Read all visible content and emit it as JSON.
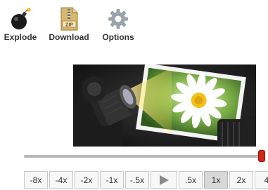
{
  "toolbar": {
    "explode_label": "Explode",
    "download_label": "Download",
    "options_label": "Options",
    "zip_badge": "ZIP"
  },
  "playback": {
    "position": 0.99,
    "speeds_left": [
      "-8x",
      "-4x",
      "-2x",
      "-1x",
      "-.5x"
    ],
    "speeds_right": [
      ".5x",
      "1x",
      "2x",
      "4"
    ],
    "active_speed": "1x"
  },
  "colors": {
    "thumb": "#d62418",
    "track": "#b9b9b9"
  },
  "icons": {
    "explode": "bomb-icon",
    "download": "zip-file-icon",
    "options": "gear-icon",
    "play": "play-icon"
  }
}
